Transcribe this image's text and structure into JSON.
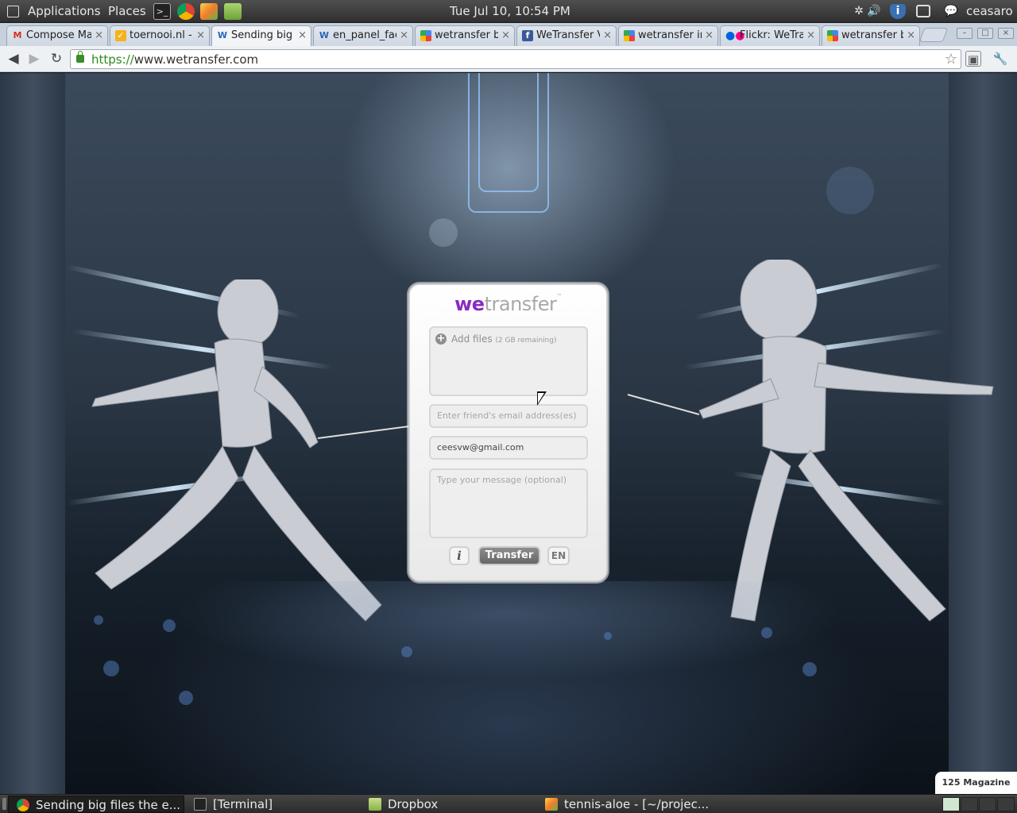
{
  "top_panel": {
    "applications_label": "Applications",
    "places_label": "Places",
    "clock": "Tue Jul 10, 10:54 PM",
    "username": "ceasaro"
  },
  "tabs": [
    {
      "title": "Compose Ma",
      "favicon": "gmail-icon"
    },
    {
      "title": "toernooi.nl -",
      "favicon": "toernooi-icon"
    },
    {
      "title": "Sending big",
      "favicon": "wetransfer-w-icon",
      "active": true
    },
    {
      "title": "en_panel_fac",
      "favicon": "wetransfer-w-icon"
    },
    {
      "title": "wetransfer b",
      "favicon": "google-icon"
    },
    {
      "title": "WeTransfer V",
      "favicon": "facebook-icon"
    },
    {
      "title": "wetransfer ir",
      "favicon": "google-icon"
    },
    {
      "title": "Flickr: WeTra",
      "favicon": "flickr-icon"
    },
    {
      "title": "wetransfer b",
      "favicon": "google-icon"
    }
  ],
  "address_bar": {
    "scheme": "https://",
    "host": "www.wetransfer.com"
  },
  "wetransfer": {
    "logo_we": "we",
    "logo_transfer": "transfer",
    "logo_tm": "™",
    "add_files_label": "Add files",
    "add_files_remaining": "(2 GB remaining)",
    "friend_email_placeholder": "Enter friend's email address(es)",
    "your_email_value": "ceesvw@gmail.com",
    "message_placeholder": "Type your message (optional)",
    "info_label": "i",
    "transfer_label": "Transfer",
    "language_label": "EN",
    "accent_color": "#8a2bc0"
  },
  "credit_badge": "125 Magazine",
  "taskbar": [
    {
      "label": "Sending big files the e...",
      "icon": "chrome-icon",
      "active": true
    },
    {
      "label": "[Terminal]",
      "icon": "terminal-icon"
    },
    {
      "label": "Dropbox",
      "icon": "folder-icon"
    },
    {
      "label": "tennis-aloe - [~/projec...",
      "icon": "pycharm-icon"
    }
  ]
}
